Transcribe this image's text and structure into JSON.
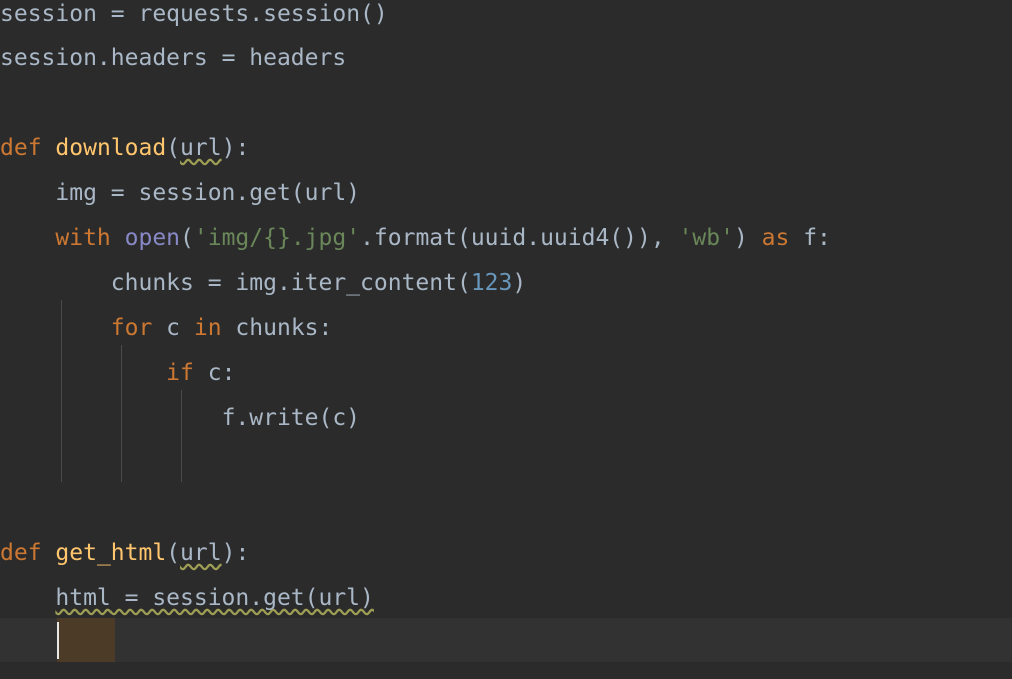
{
  "editor": {
    "language": "python",
    "background_color": "#2b2b2b",
    "current_line_color": "#323232",
    "identifier_highlight_color": "#4c3b27",
    "caret_color": "#e8e8e8",
    "indent_guide_color": "#4b4b4b",
    "default_text_color": "#a9b7c6",
    "keyword_color": "#cc7832",
    "function_color": "#ffc66d",
    "builtin_color": "#8888c6",
    "string_color": "#6a8759",
    "number_color": "#6897bb",
    "squiggle_color": "#9e9e54"
  },
  "code": {
    "line_01": {
      "t1": "session",
      "t2": " = ",
      "t3": "requests.session()"
    },
    "line_02": {
      "t1": "session.headers",
      "t2": " = ",
      "t3": "headers"
    },
    "line_04": {
      "kw": "def",
      "sp": " ",
      "fn": "download",
      "paren_open": "(",
      "arg": "url",
      "paren_close": "):"
    },
    "line_05": {
      "indent": "    ",
      "body": "img = session.get(url)"
    },
    "line_06": {
      "indent": "    ",
      "kw": "with",
      "sp1": " ",
      "bi": "open",
      "p1": "(",
      "str1": "'img/{}.jpg'",
      "mid": ".format(uuid.uuid4()), ",
      "str2": "'wb'",
      "p2": ") ",
      "kw2": "as",
      "tail": " f:"
    },
    "line_07": {
      "indent": "        ",
      "pre": "chunks = img.iter_content(",
      "num": "123",
      "post": ")"
    },
    "line_08": {
      "indent": "        ",
      "kw1": "for",
      "v": " c ",
      "kw2": "in",
      "tail": " chunks:"
    },
    "line_09": {
      "indent": "            ",
      "kw": "if",
      "tail": " c:"
    },
    "line_10": {
      "indent": "                ",
      "body": "f.write(c)"
    },
    "line_12": {
      "kw": "def",
      "sp": " ",
      "fn": "get_html",
      "paren_open": "(",
      "arg": "url",
      "paren_close": "):"
    },
    "line_13": {
      "indent": "    ",
      "ident": "html",
      "body": " = session.get(url)"
    }
  }
}
